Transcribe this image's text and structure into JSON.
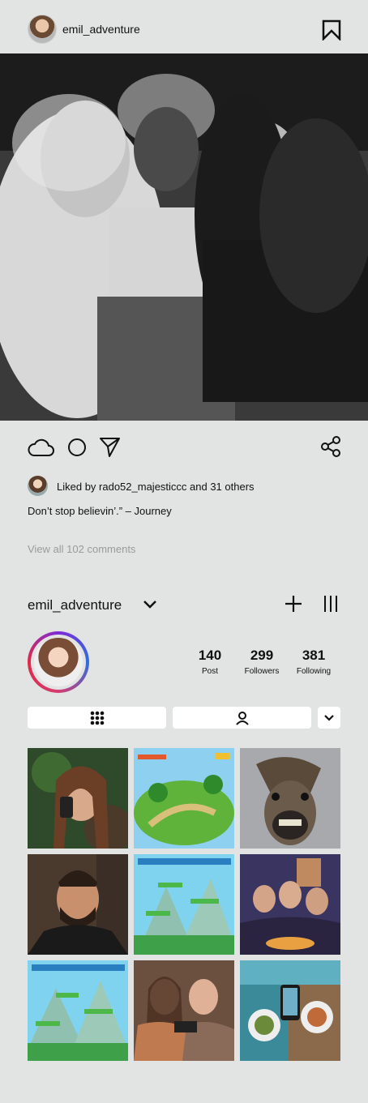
{
  "header": {
    "username": "emil_adventure",
    "avatar_icon": "profile-avatar",
    "bookmark_icon": "bookmark-icon"
  },
  "post": {
    "image_desc_icon": "post-photo",
    "actions": [
      "cloud-icon",
      "circle-icon",
      "send-icon"
    ],
    "share_icon": "share-icon",
    "likes_text": "Liked by rado52_majesticcc and 31 others",
    "caption": "Don’t stop believin’.” – Journey",
    "view_comments": "View all 102 comments"
  },
  "profile": {
    "username": "emil_adventure",
    "stats": [
      {
        "value": "140",
        "label": "Post"
      },
      {
        "value": "299",
        "label": "Followers"
      },
      {
        "value": "381",
        "label": "Following"
      }
    ]
  },
  "colors": {
    "background": "#e2e4e3",
    "muted_text": "#9a9a9a",
    "ring_gradient": [
      "#7d2ad8",
      "#2f6ee0",
      "#d43c6f"
    ]
  },
  "grid": {
    "tiles": [
      "portrait-woman-green",
      "game-map-island",
      "horse-face",
      "man-barbershop",
      "game-jungle-level",
      "friends-dinner",
      "game-jungle-level-2",
      "women-phone-laughing",
      "food-table-phone"
    ]
  }
}
